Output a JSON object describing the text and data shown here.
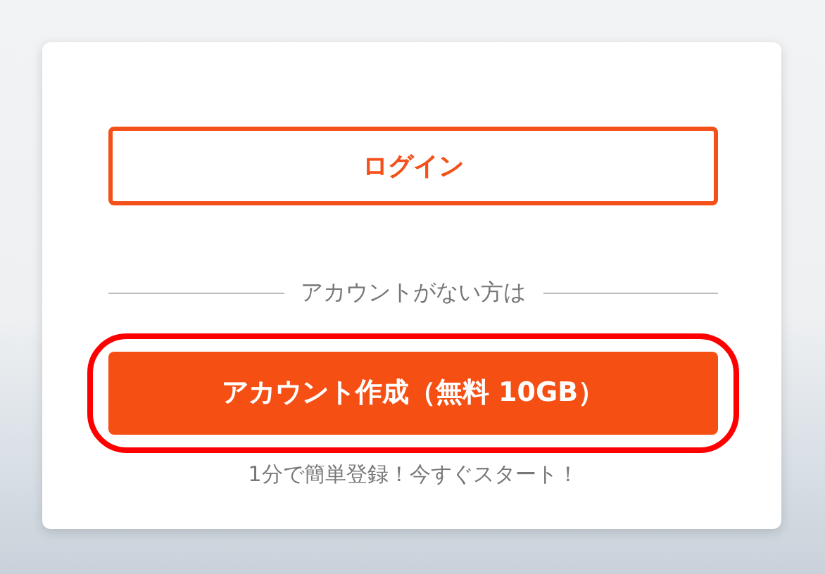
{
  "login_button": {
    "label": "ログイン"
  },
  "divider": {
    "label": "アカウントがない方は"
  },
  "signup_button": {
    "label": "アカウント作成（無料 10GB）",
    "highlighted": true
  },
  "note": "1分で簡単登録！今すぐスタート！"
}
